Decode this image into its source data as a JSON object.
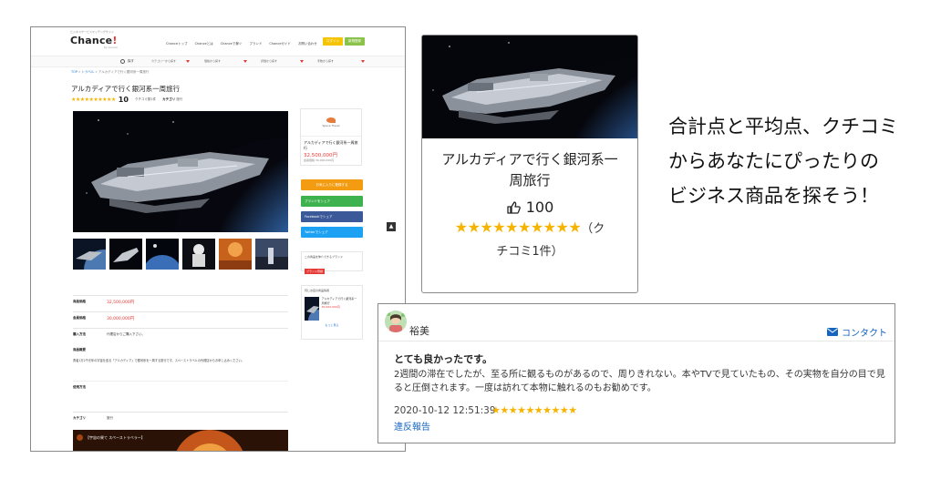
{
  "site": {
    "logo_small": "ビジネスサービスマッチングサイト",
    "logo_main": "Chance",
    "logo_bang": "!",
    "logo_sub": "by Luxure",
    "nav": [
      "Chanceトップ",
      "Chanceとは",
      "Chanceで稼ぐ",
      "ブランド",
      "Chanceガイド",
      "お問い合わせ"
    ],
    "btn_login": "ログイン",
    "btn_register": "新規登録",
    "search_label": "探す",
    "filters": [
      "カテゴリーから探す",
      "価格から探す",
      "評価から探す",
      "手数から探す"
    ]
  },
  "breadcrumb": {
    "top": "TOP",
    "category": "トラベル",
    "current": "アルカディアで行く銀河系一周旅行"
  },
  "product": {
    "title": "アルカディアで行く銀河系一周旅行",
    "stars": "★★★★★★★★★★",
    "score": "10",
    "review_count_label": "クチコミ数1件",
    "category_label": "カテゴリ",
    "category_value": "旅行"
  },
  "sidecard": {
    "logo_text": "Space Travel",
    "title": "アルカディアで行く銀河系一周旅行",
    "price": "32,500,000円",
    "member_price": "会員価格 30,000,000円",
    "btn_fav": "お気に入りに登録する",
    "btn_line": "ブランドをシェア",
    "btn_fb": "Facebookでシェア",
    "btn_tw": "Twitterでシェア",
    "box2_text": "この商品を仲介できるブランド",
    "box2_badge": "ブランド登録",
    "box3_title": "同じお店の商品情報",
    "box3_item": "アルカディアで行く銀河系一周旅行",
    "box3_price": "30,000,000円",
    "box3_more": "もっと見る"
  },
  "info": {
    "price_label": "商品価格",
    "price_value": "32,500,000円",
    "member_label": "会員価格",
    "member_value": "30,000,000円",
    "purchase_label": "購入方法",
    "purchase_value": "代理店からご購入下さい。",
    "overview_label": "商品概要",
    "overview_text": "勇者1万2千光年の宇宙を巡る「アルカディア」で銀河系を一周する旅行です。スペーストラベルの代理店からお申し込みください。",
    "usage_label": "使用方法",
    "category_label": "カテゴリ",
    "category_value": "旅行",
    "video_title": "【宇宙の果て スペーストラベラー】"
  },
  "card": {
    "title": "アルカディアで行く銀河系一周旅行",
    "likes": "100",
    "stars": "★★★★★★★★★★",
    "review_label_a": "（ク",
    "review_label_b": "チコミ1件）"
  },
  "tagline": {
    "line1": "合計点と平均点、クチコミ",
    "line2": "からあなたにぴったりの",
    "line3": "ビジネス商品を探そう！"
  },
  "review": {
    "name": "裕美",
    "contact_label": "コンタクト",
    "headline": "とても良かったです。",
    "body": "2週間の滞在でしたが、至る所に観るものがあるので、周りきれない。本やTVで見ていたもの、その実物を自分の目で見ると圧倒されます。一度は訪れて本物に触れるのもお勧めです。",
    "date": "2020-10-12 12:51:39",
    "stars": "★★★★★★★★★★",
    "report_label": "違反報告"
  },
  "colors": {
    "accent_red": "#e53935",
    "star": "#f5b400",
    "link": "#1565c0",
    "line_green": "#3eb24e",
    "facebook": "#3b5998",
    "twitter": "#1da1f2"
  }
}
